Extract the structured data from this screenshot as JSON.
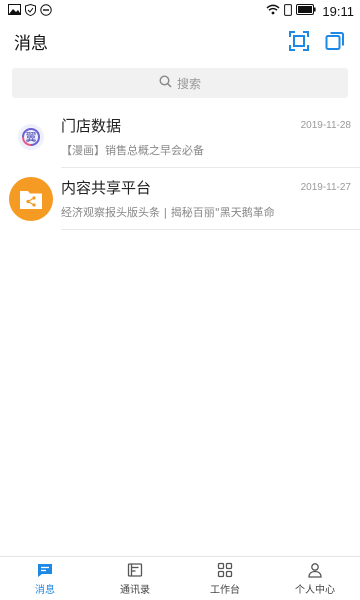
{
  "status_bar": {
    "time": "19:11"
  },
  "header": {
    "title": "消息"
  },
  "search": {
    "placeholder": "搜索"
  },
  "messages": [
    {
      "title": "门店数据",
      "date": "2019-11-28",
      "subtitle": "【漫画】销售总概之早会必备"
    },
    {
      "title": "内容共享平台",
      "date": "2019-11-27",
      "subtitle": "经济观察报头版头条 | 揭秘百丽\"黑天鹅革命"
    }
  ],
  "tabs": [
    {
      "label": "消息",
      "active": true
    },
    {
      "label": "通讯录",
      "active": false
    },
    {
      "label": "工作台",
      "active": false
    },
    {
      "label": "个人中心",
      "active": false
    }
  ],
  "colors": {
    "accent": "#1e88e5",
    "share_avatar": "#f59a23"
  }
}
